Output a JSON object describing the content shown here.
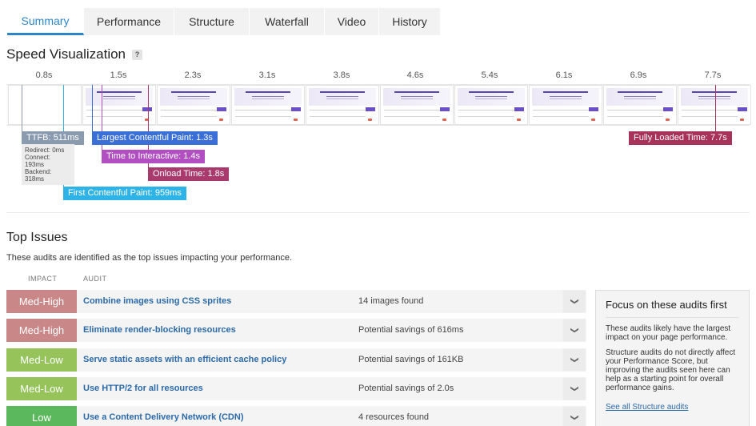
{
  "tabs": [
    "Summary",
    "Performance",
    "Structure",
    "Waterfall",
    "Video",
    "History"
  ],
  "active_tab": "Summary",
  "speed_visualization": {
    "title": "Speed Visualization",
    "help": "?",
    "ticks": [
      "0.8s",
      "1.5s",
      "2.3s",
      "3.1s",
      "3.8s",
      "4.6s",
      "5.4s",
      "6.1s",
      "6.9s",
      "7.7s"
    ],
    "markers": {
      "ttfb": "TTFB: 511ms",
      "ttfb_details": [
        "Redirect: 0ms",
        "Connect: 193ms",
        "Backend: 318ms"
      ],
      "lcp": "Largest Contentful Paint: 1.3s",
      "tti": "Time to Interactive: 1.4s",
      "onload": "Onload Time: 1.8s",
      "fcp": "First Contentful Paint: 959ms",
      "fully_loaded": "Fully Loaded Time: 7.7s"
    },
    "colors": {
      "ttfb": "#8a9bb0",
      "lcp": "#3a6fd8",
      "tti": "#b04ec2",
      "onload": "#a83a6e",
      "fcp": "#2db3e6",
      "fully_loaded": "#a8325a"
    }
  },
  "top_issues": {
    "title": "Top Issues",
    "description": "These audits are identified as the top issues impacting your performance.",
    "col_impact": "IMPACT",
    "col_audit": "AUDIT",
    "rows": [
      {
        "impact": "Med-High",
        "audit": "Combine images using CSS sprites",
        "finding": "14 images found",
        "color": "#c98787"
      },
      {
        "impact": "Med-High",
        "audit": "Eliminate render-blocking resources",
        "finding": "Potential savings of 616ms",
        "color": "#c98787"
      },
      {
        "impact": "Med-Low",
        "audit": "Serve static assets with an efficient cache policy",
        "finding": "Potential savings of 161KB",
        "color": "#96c35a"
      },
      {
        "impact": "Med-Low",
        "audit": "Use HTTP/2 for all resources",
        "finding": "Potential savings of 2.0s",
        "color": "#96c35a"
      },
      {
        "impact": "Low",
        "audit": "Use a Content Delivery Network (CDN)",
        "finding": "4 resources found",
        "color": "#5cb85c"
      }
    ]
  },
  "focus": {
    "title": "Focus on these audits first",
    "p1": "These audits likely have the largest impact on your page performance.",
    "p2": "Structure audits do not directly affect your Performance Score, but improving the audits seen here can help as a starting point for overall performance gains.",
    "link": "See all Structure audits"
  }
}
